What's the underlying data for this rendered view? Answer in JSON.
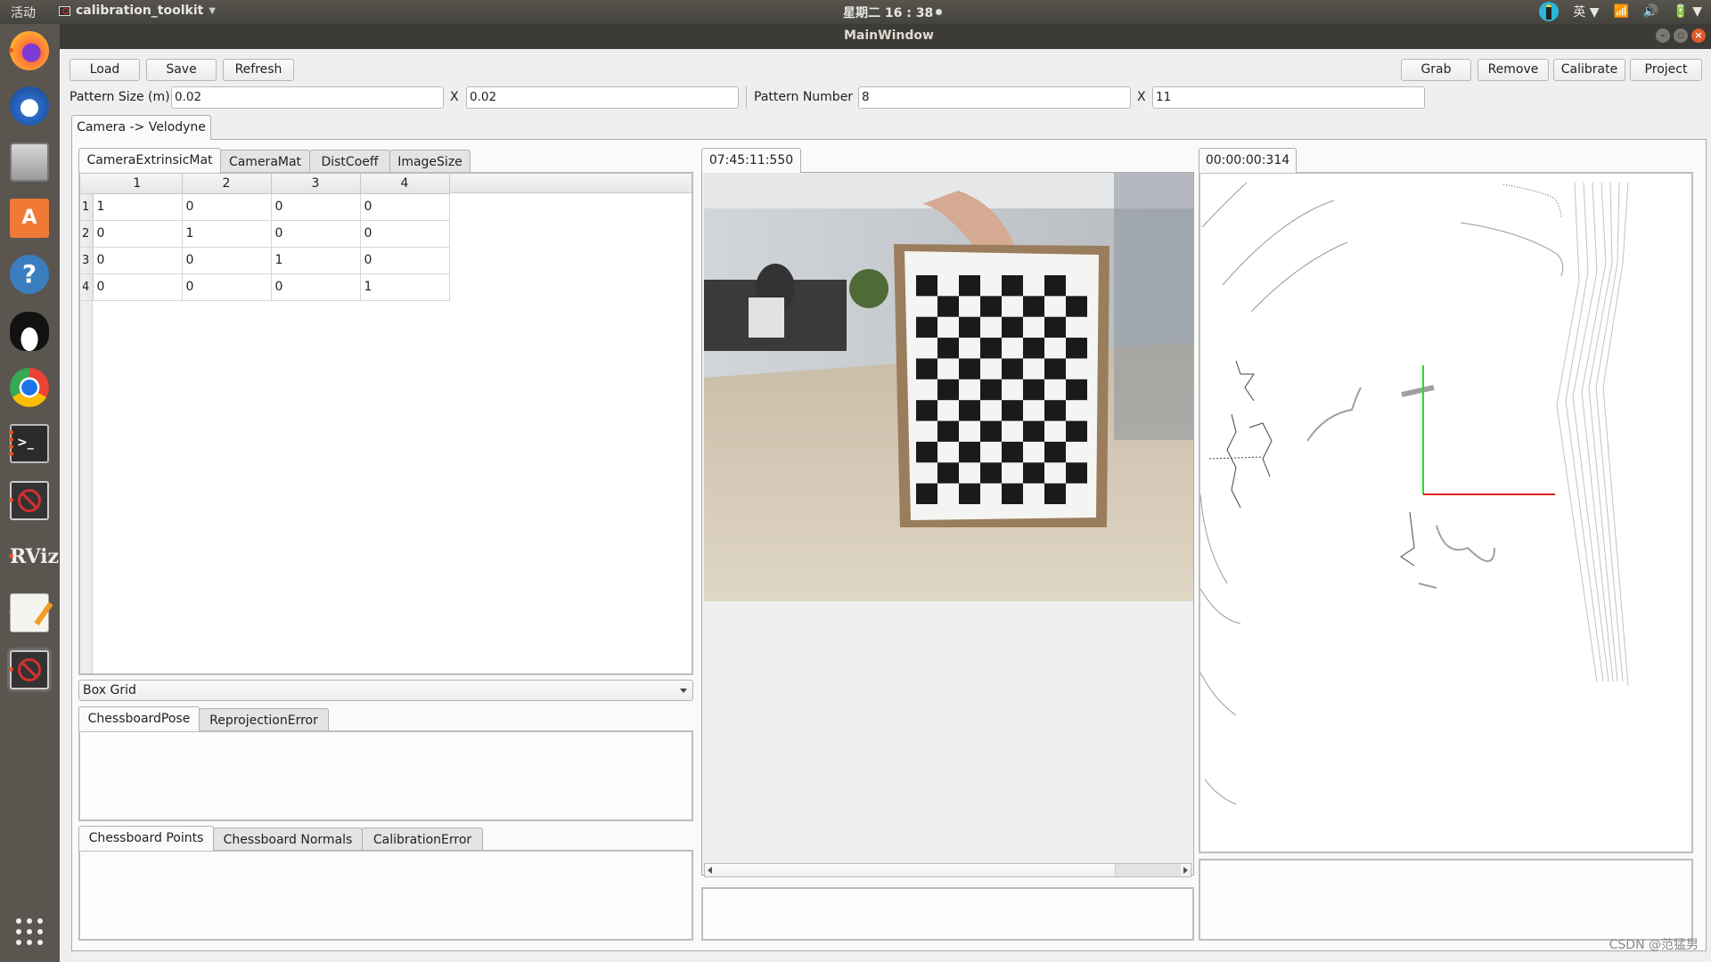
{
  "topbar": {
    "activities": "活动",
    "app_name": "calibration_toolkit",
    "clock": "星期二 16 : 38",
    "input_method": "英"
  },
  "window": {
    "title": "MainWindow"
  },
  "dock": {
    "items": [
      {
        "name": "firefox",
        "running": true
      },
      {
        "name": "thunderbird",
        "running": false
      },
      {
        "name": "files",
        "running": false
      },
      {
        "name": "software-center",
        "running": false
      },
      {
        "name": "help",
        "running": false
      },
      {
        "name": "qq",
        "running": false
      },
      {
        "name": "chrome",
        "running": false
      },
      {
        "name": "terminal",
        "running": true,
        "label": ">_"
      },
      {
        "name": "calibration-app",
        "running": true
      },
      {
        "name": "rviz",
        "running": true,
        "label": "RViz"
      },
      {
        "name": "text-editor",
        "running": true
      },
      {
        "name": "calibration-app-active",
        "running": true
      }
    ]
  },
  "toolbar": {
    "load": "Load",
    "save": "Save",
    "refresh": "Refresh",
    "grab": "Grab",
    "remove": "Remove",
    "calibrate": "Calibrate",
    "project": "Project"
  },
  "pattern": {
    "size_label": "Pattern Size (m)",
    "size_x": "0.02",
    "size_sep": "X",
    "size_y": "0.02",
    "number_label": "Pattern Number",
    "number_x": "8",
    "number_sep": "X",
    "number_y": "11"
  },
  "outer_tab": {
    "label": "Camera -> Velodyne"
  },
  "param_tabs": [
    "CameraExtrinsicMat",
    "CameraMat",
    "DistCoeff",
    "ImageSize"
  ],
  "matrix": {
    "columns": [
      "1",
      "2",
      "3",
      "4"
    ],
    "rows": [
      {
        "header": "1",
        "cells": [
          "1",
          "0",
          "0",
          "0"
        ]
      },
      {
        "header": "2",
        "cells": [
          "0",
          "1",
          "0",
          "0"
        ]
      },
      {
        "header": "3",
        "cells": [
          "0",
          "0",
          "1",
          "0"
        ]
      },
      {
        "header": "4",
        "cells": [
          "0",
          "0",
          "0",
          "1"
        ]
      }
    ]
  },
  "grid_combo": {
    "selected": "Box Grid"
  },
  "pose_tabs": [
    "ChessboardPose",
    "ReprojectionError"
  ],
  "points_tabs": [
    "Chessboard Points",
    "Chessboard Normals",
    "CalibrationError"
  ],
  "camera_view": {
    "timestamp": "07:45:11:550",
    "chessboard_cols": 8,
    "chessboard_rows": 11
  },
  "lidar_view": {
    "timestamp": "00:00:00:314",
    "axis_colors": {
      "x": "#e02020",
      "y": "#20e020"
    }
  },
  "watermark": "CSDN @范猛男"
}
